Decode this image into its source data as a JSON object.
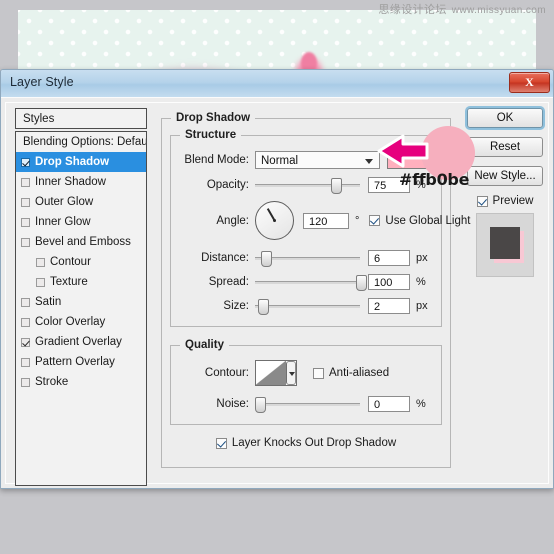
{
  "watermark": {
    "chinese": "思缘设计论坛",
    "url": "www.missyuan.com"
  },
  "dialog": {
    "title": "Layer Style",
    "close_label": "X"
  },
  "styles_panel": {
    "header": "Styles",
    "items": [
      {
        "label": "Blending Options: Default",
        "checkbox": false,
        "has_checkbox": false,
        "selected": false,
        "indent": false
      },
      {
        "label": "Drop Shadow",
        "checkbox": true,
        "has_checkbox": true,
        "selected": true,
        "indent": false
      },
      {
        "label": "Inner Shadow",
        "checkbox": false,
        "has_checkbox": true,
        "selected": false,
        "indent": false
      },
      {
        "label": "Outer Glow",
        "checkbox": false,
        "has_checkbox": true,
        "selected": false,
        "indent": false
      },
      {
        "label": "Inner Glow",
        "checkbox": false,
        "has_checkbox": true,
        "selected": false,
        "indent": false
      },
      {
        "label": "Bevel and Emboss",
        "checkbox": false,
        "has_checkbox": true,
        "selected": false,
        "indent": false
      },
      {
        "label": "Contour",
        "checkbox": false,
        "has_checkbox": true,
        "selected": false,
        "indent": true
      },
      {
        "label": "Texture",
        "checkbox": false,
        "has_checkbox": true,
        "selected": false,
        "indent": true
      },
      {
        "label": "Satin",
        "checkbox": false,
        "has_checkbox": true,
        "selected": false,
        "indent": false
      },
      {
        "label": "Color Overlay",
        "checkbox": false,
        "has_checkbox": true,
        "selected": false,
        "indent": false
      },
      {
        "label": "Gradient Overlay",
        "checkbox": true,
        "has_checkbox": true,
        "selected": false,
        "indent": false
      },
      {
        "label": "Pattern Overlay",
        "checkbox": false,
        "has_checkbox": true,
        "selected": false,
        "indent": false
      },
      {
        "label": "Stroke",
        "checkbox": false,
        "has_checkbox": true,
        "selected": false,
        "indent": false
      }
    ]
  },
  "drop_shadow": {
    "group_label": "Drop Shadow",
    "structure": {
      "group_label": "Structure",
      "blend_mode": {
        "label": "Blend Mode:",
        "value": "Normal"
      },
      "color_swatch": "#ffb0be",
      "opacity": {
        "label": "Opacity:",
        "value": "75",
        "unit": "%",
        "percent": 75
      },
      "angle": {
        "label": "Angle:",
        "value": "120",
        "unit": "°",
        "degrees": 120
      },
      "use_global_light": {
        "label": "Use Global Light",
        "checked": true
      },
      "distance": {
        "label": "Distance:",
        "value": "6",
        "unit": "px",
        "percent": 6
      },
      "spread": {
        "label": "Spread:",
        "value": "100",
        "unit": "%",
        "percent": 100
      },
      "size": {
        "label": "Size:",
        "value": "2",
        "unit": "px",
        "percent": 3
      }
    },
    "quality": {
      "group_label": "Quality",
      "contour": {
        "label": "Contour:"
      },
      "anti_aliased": {
        "label": "Anti-aliased",
        "checked": false
      },
      "noise": {
        "label": "Noise:",
        "value": "0",
        "unit": "%",
        "percent": 0
      },
      "knocks_out": {
        "label": "Layer Knocks Out Drop Shadow",
        "checked": true
      }
    }
  },
  "side_buttons": {
    "ok": "OK",
    "reset": "Reset",
    "new_style": "New Style...",
    "preview": {
      "label": "Preview",
      "checked": true
    }
  },
  "annotation": {
    "color_code": "#ffb0be",
    "arrow_color": "#e6007e",
    "circle_color": "#f6afbe"
  }
}
